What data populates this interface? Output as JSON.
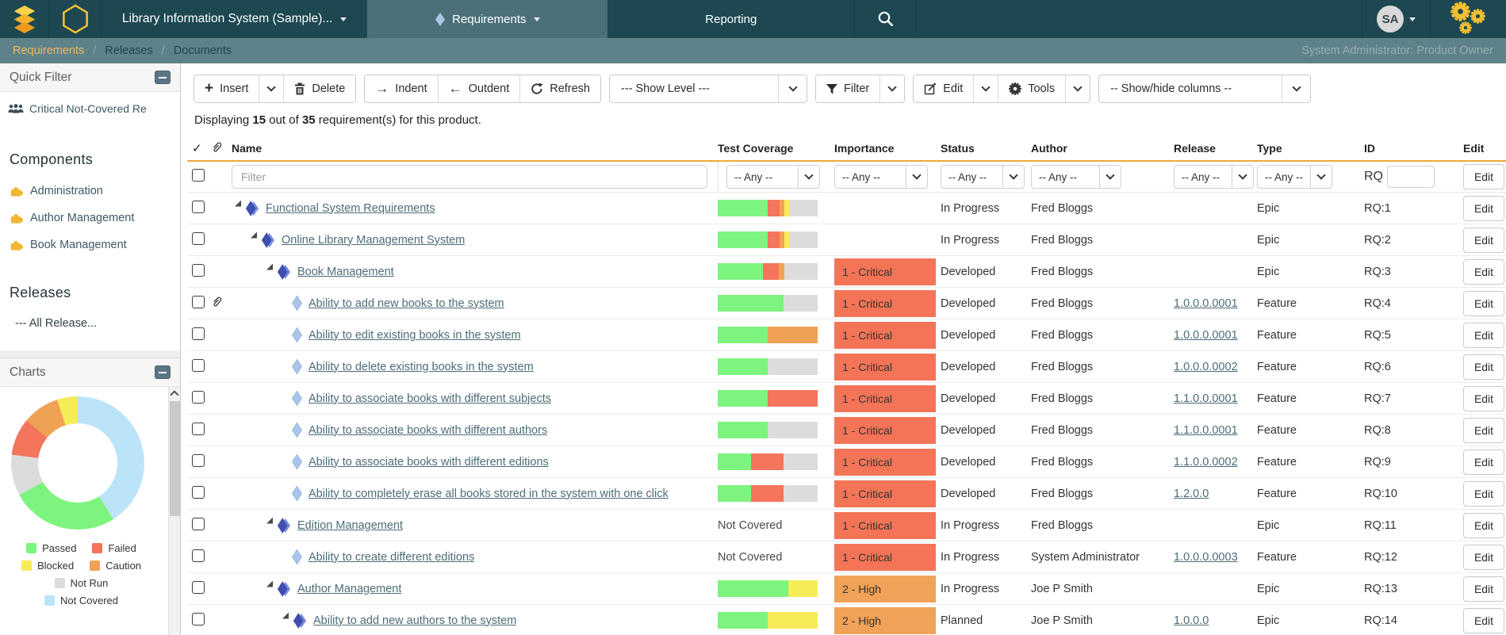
{
  "colors": {
    "passed": "#7df47d",
    "failed": "#f4745c",
    "blocked": "#f5ec57",
    "caution": "#f0a254",
    "notrun": "#dcdcdc",
    "notcovered": "#bce4f9",
    "critical": "#f47457",
    "high": "#f0a258",
    "accent": "#f0a73c"
  },
  "navbar": {
    "product": "Library Information System (Sample)...",
    "tab_requirements": "Requirements",
    "tab_reporting": "Reporting",
    "avatar": "SA"
  },
  "breadcrumb": {
    "links": [
      "Requirements",
      "Releases",
      "Documents"
    ],
    "separator": "/",
    "user": "System Administrator: Product Owner"
  },
  "sidebar": {
    "quick_filter": {
      "title": "Quick Filter",
      "item": "Critical Not-Covered Re"
    },
    "components": {
      "title": "Components",
      "items": [
        "Administration",
        "Author Management",
        "Book Management"
      ]
    },
    "releases": {
      "title": "Releases",
      "item": "--- All Release..."
    },
    "charts": {
      "title": "Charts",
      "donut": [
        [
          "notcovered",
          41
        ],
        [
          "passed",
          26
        ],
        [
          "notrun",
          10
        ],
        [
          "failed",
          9
        ],
        [
          "caution",
          9
        ],
        [
          "blocked",
          5
        ]
      ],
      "legend": [
        {
          "key": "passed",
          "label": "Passed"
        },
        {
          "key": "failed",
          "label": "Failed"
        },
        {
          "key": "blocked",
          "label": "Blocked"
        },
        {
          "key": "caution",
          "label": "Caution"
        },
        {
          "key": "notrun",
          "label": "Not Run"
        },
        {
          "key": "notcovered",
          "label": "Not Covered"
        }
      ]
    }
  },
  "toolbar": {
    "insert": "Insert",
    "delete": "Delete",
    "indent": "Indent",
    "outdent": "Outdent",
    "refresh": "Refresh",
    "show_level": "--- Show Level ---",
    "filter": "Filter",
    "edit": "Edit",
    "tools": "Tools",
    "show_hide": "-- Show/hide columns --"
  },
  "summary": {
    "text_1": "Displaying",
    "count": "15",
    "text_2": "out of",
    "total": "35",
    "text_3": "requirement(s) for this product."
  },
  "table": {
    "columns": [
      "Name",
      "Test Coverage",
      "Importance",
      "Status",
      "Author",
      "Release",
      "Type",
      "ID",
      "Edit"
    ],
    "filter": {
      "placeholder": "Filter",
      "any": "-- Any --",
      "id_prefix": "RQ"
    },
    "edit_label": "Edit",
    "rows": [
      {
        "name": "Functional System Requirements",
        "level": 0,
        "expand": true,
        "icon": "epic",
        "attach": false,
        "cov": [
          [
            "passed",
            50
          ],
          [
            "failed",
            12
          ],
          [
            "caution",
            5
          ],
          [
            "blocked",
            5
          ],
          [
            "notrun",
            28
          ]
        ],
        "importance": null,
        "status": "In Progress",
        "author": "Fred Bloggs",
        "release": "",
        "type": "Epic",
        "id": "RQ:1"
      },
      {
        "name": "Online Library Management System",
        "level": 1,
        "expand": true,
        "icon": "epic",
        "attach": false,
        "cov": [
          [
            "passed",
            50
          ],
          [
            "failed",
            12
          ],
          [
            "caution",
            5
          ],
          [
            "blocked",
            5
          ],
          [
            "notrun",
            28
          ]
        ],
        "importance": null,
        "status": "In Progress",
        "author": "Fred Bloggs",
        "release": "",
        "type": "Epic",
        "id": "RQ:2"
      },
      {
        "name": "Book Management",
        "level": 2,
        "expand": true,
        "icon": "epic",
        "attach": false,
        "cov": [
          [
            "passed",
            45
          ],
          [
            "failed",
            16
          ],
          [
            "caution",
            6
          ],
          [
            "notrun",
            33
          ]
        ],
        "importance": {
          "label": "1 - Critical",
          "key": "critical"
        },
        "status": "Developed",
        "author": "Fred Bloggs",
        "release": "",
        "type": "Epic",
        "id": "RQ:3"
      },
      {
        "name": "Ability to add new books to the system",
        "level": 3,
        "expand": false,
        "icon": "feature",
        "attach": true,
        "cov": [
          [
            "passed",
            66
          ],
          [
            "notrun",
            34
          ]
        ],
        "importance": {
          "label": "1 - Critical",
          "key": "critical"
        },
        "status": "Developed",
        "author": "Fred Bloggs",
        "release": "1.0.0.0.0001",
        "type": "Feature",
        "id": "RQ:4"
      },
      {
        "name": "Ability to edit existing books in the system",
        "level": 3,
        "expand": false,
        "icon": "feature",
        "attach": false,
        "cov": [
          [
            "passed",
            50
          ],
          [
            "caution",
            50
          ]
        ],
        "importance": {
          "label": "1 - Critical",
          "key": "critical"
        },
        "status": "Developed",
        "author": "Fred Bloggs",
        "release": "1.0.0.0.0001",
        "type": "Feature",
        "id": "RQ:5"
      },
      {
        "name": "Ability to delete existing books in the system",
        "level": 3,
        "expand": false,
        "icon": "feature",
        "attach": false,
        "cov": [
          [
            "passed",
            50
          ],
          [
            "notrun",
            50
          ]
        ],
        "importance": {
          "label": "1 - Critical",
          "key": "critical"
        },
        "status": "Developed",
        "author": "Fred Bloggs",
        "release": "1.0.0.0.0002",
        "type": "Feature",
        "id": "RQ:6"
      },
      {
        "name": "Ability to associate books with different subjects",
        "level": 3,
        "expand": false,
        "icon": "feature",
        "attach": false,
        "cov": [
          [
            "passed",
            50
          ],
          [
            "failed",
            50
          ]
        ],
        "importance": {
          "label": "1 - Critical",
          "key": "critical"
        },
        "status": "Developed",
        "author": "Fred Bloggs",
        "release": "1.1.0.0.0001",
        "type": "Feature",
        "id": "RQ:7"
      },
      {
        "name": "Ability to associate books with different authors",
        "level": 3,
        "expand": false,
        "icon": "feature",
        "attach": false,
        "cov": [
          [
            "passed",
            50
          ],
          [
            "notrun",
            50
          ]
        ],
        "importance": {
          "label": "1 - Critical",
          "key": "critical"
        },
        "status": "Developed",
        "author": "Fred Bloggs",
        "release": "1.1.0.0.0001",
        "type": "Feature",
        "id": "RQ:8"
      },
      {
        "name": "Ability to associate books with different editions",
        "level": 3,
        "expand": false,
        "icon": "feature",
        "attach": false,
        "cov": [
          [
            "passed",
            33
          ],
          [
            "failed",
            33
          ],
          [
            "notrun",
            34
          ]
        ],
        "importance": {
          "label": "1 - Critical",
          "key": "critical"
        },
        "status": "Developed",
        "author": "Fred Bloggs",
        "release": "1.1.0.0.0002",
        "type": "Feature",
        "id": "RQ:9"
      },
      {
        "name": "Ability to completely erase all books stored in the system with one click",
        "level": 3,
        "expand": false,
        "icon": "feature",
        "attach": false,
        "cov": [
          [
            "passed",
            33
          ],
          [
            "failed",
            33
          ],
          [
            "notrun",
            34
          ]
        ],
        "importance": {
          "label": "1 - Critical",
          "key": "critical"
        },
        "status": "Developed",
        "author": "Fred Bloggs",
        "release": "1.2.0.0",
        "type": "Feature",
        "id": "RQ:10"
      },
      {
        "name": "Edition Management",
        "level": 2,
        "expand": true,
        "icon": "epic",
        "attach": false,
        "cov": null,
        "cov_text": "Not Covered",
        "importance": {
          "label": "1 - Critical",
          "key": "critical"
        },
        "status": "In Progress",
        "author": "Fred Bloggs",
        "release": "",
        "type": "Epic",
        "id": "RQ:11"
      },
      {
        "name": "Ability to create different editions",
        "level": 3,
        "expand": false,
        "icon": "feature",
        "attach": false,
        "cov": null,
        "cov_text": "Not Covered",
        "importance": {
          "label": "1 - Critical",
          "key": "critical"
        },
        "status": "In Progress",
        "author": "System Administrator",
        "release": "1.0.0.0.0003",
        "type": "Feature",
        "id": "RQ:12"
      },
      {
        "name": "Author Management",
        "level": 2,
        "expand": true,
        "icon": "epic",
        "attach": false,
        "cov": [
          [
            "passed",
            71
          ],
          [
            "blocked",
            29
          ]
        ],
        "importance": {
          "label": "2 - High",
          "key": "high"
        },
        "status": "In Progress",
        "author": "Joe P Smith",
        "release": "",
        "type": "Epic",
        "id": "RQ:13"
      },
      {
        "name": "Ability to add new authors to the system",
        "level": 3,
        "expand": true,
        "icon": "epic",
        "attach": false,
        "cov": [
          [
            "passed",
            50
          ],
          [
            "blocked",
            50
          ]
        ],
        "importance": {
          "label": "2 - High",
          "key": "high"
        },
        "status": "Planned",
        "author": "Joe P Smith",
        "release": "1.0.0.0",
        "type": "Epic",
        "id": "RQ:14"
      }
    ]
  }
}
